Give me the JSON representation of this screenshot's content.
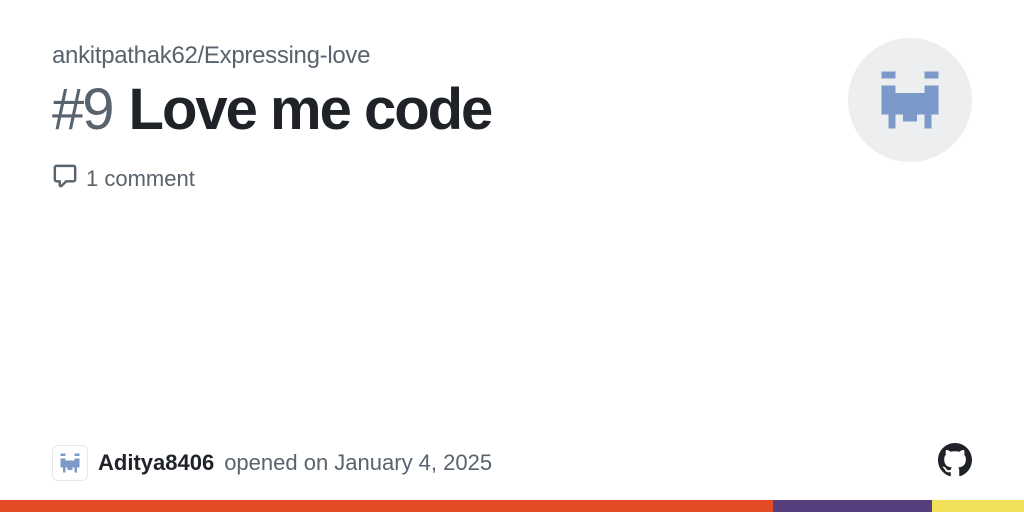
{
  "repo": {
    "path": "ankitpathak62/Expressing-love"
  },
  "issue": {
    "number_display": "#9",
    "title": "Love me code",
    "comments_text": "1 comment"
  },
  "author": {
    "name": "Aditya8406",
    "opened_text": "opened on January 4, 2025"
  },
  "colors": {
    "muted": "#59636e",
    "text": "#1f2328",
    "avatar_fg": "#7b9ac9"
  }
}
